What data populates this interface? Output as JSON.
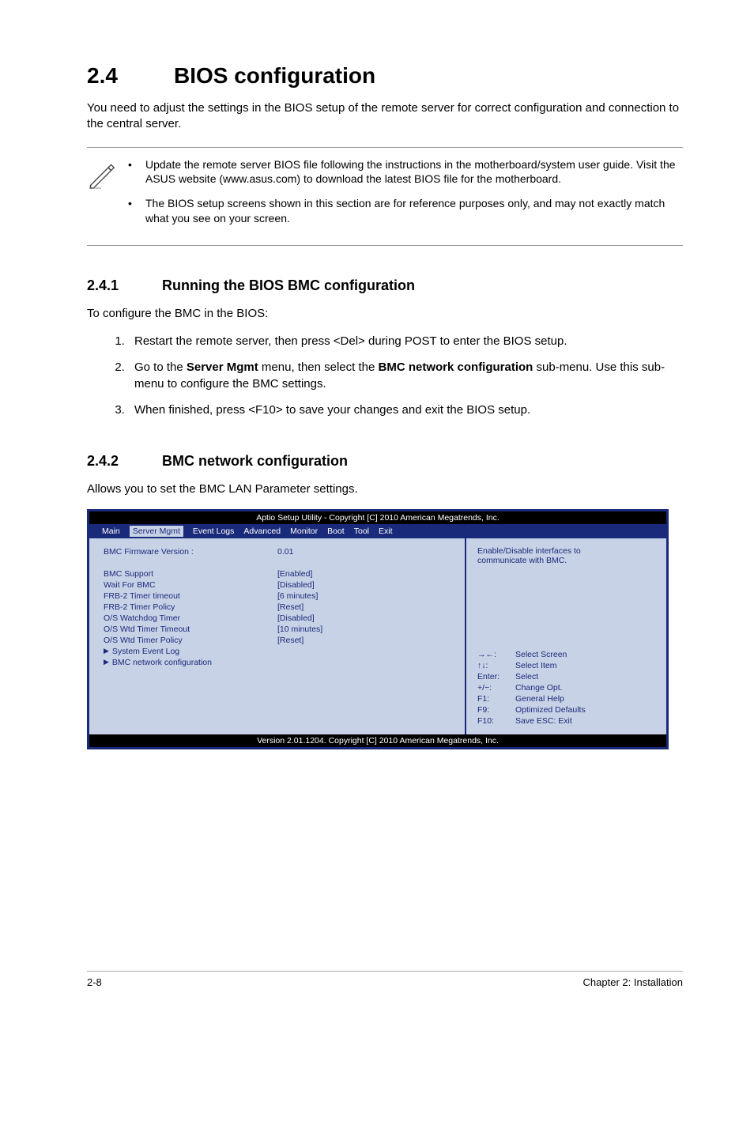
{
  "h1": {
    "num": "2.4",
    "title": "BIOS configuration"
  },
  "intro": "You need to adjust the settings in the BIOS setup of the remote server for correct configuration and connection to the central server.",
  "notes": [
    "Update the remote server BIOS file following the instructions in the motherboard/system user guide. Visit the ASUS website (www.asus.com) to download the latest BIOS file for the motherboard.",
    "The BIOS setup screens shown in this section are for reference purposes only, and may not exactly match what you see on your screen."
  ],
  "s241": {
    "num": "2.4.1",
    "title": "Running the BIOS BMC configuration"
  },
  "s241_intro": "To configure the BMC in the BIOS:",
  "steps": [
    "Restart the remote server, then press <Del> during POST to enter the BIOS setup.",
    {
      "pre": "Go to the ",
      "b1": "Server Mgmt",
      "mid": " menu, then select the ",
      "b2": "BMC network configuration",
      "post": " sub-menu. Use this sub-menu to configure the BMC settings."
    },
    "When finished, press <F10> to save your changes and exit the BIOS setup."
  ],
  "s242": {
    "num": "2.4.2",
    "title": "BMC network configuration"
  },
  "s242_intro": "Allows you to set the BMC LAN Parameter settings.",
  "bios": {
    "title": "Aptio Setup Utility - Copyright [C] 2010 American Megatrends, Inc.",
    "menu": [
      "Main",
      "Server Mgmt",
      "Event Logs",
      "Advanced",
      "Monitor",
      "Boot",
      "Tool",
      "Exit"
    ],
    "selected_menu": "Server Mgmt",
    "rows": [
      {
        "label": "BMC Firmware Version :",
        "val": "0.01"
      },
      {
        "label": "",
        "val": ""
      },
      {
        "label": "BMC Support",
        "val": "[Enabled]"
      },
      {
        "label": "Wait For BMC",
        "val": "[Disabled]"
      },
      {
        "label": "FRB-2 Timer timeout",
        "val": "[6 minutes]"
      },
      {
        "label": "FRB-2 Timer Policy",
        "val": "[Reset]"
      },
      {
        "label": "O/S Watchdog Timer",
        "val": "[Disabled]"
      },
      {
        "label": "O/S Wtd Timer Timeout",
        "val": "[10 minutes]"
      },
      {
        "label": "O/S Wtd Timer Policy",
        "val": "[Reset]"
      }
    ],
    "sub1": "System Event Log",
    "sub2": "BMC network configuration",
    "help_top1": "Enable/Disable interfaces to",
    "help_top2": "communicate with BMC.",
    "help_keys": [
      {
        "k": "→←:",
        "d": "Select Screen"
      },
      {
        "k": "↑↓:",
        "d": "Select Item"
      },
      {
        "k": "Enter:",
        "d": "Select"
      },
      {
        "k": "+/−:",
        "d": "Change Opt."
      },
      {
        "k": "F1:",
        "d": "General Help"
      },
      {
        "k": "F9:",
        "d": "Optimized Defaults"
      },
      {
        "k": "F10:",
        "d": "Save   ESC: Exit"
      }
    ],
    "footer": "Version 2.01.1204. Copyright [C] 2010 American Megatrends, Inc."
  },
  "foot": {
    "left": "2-8",
    "right": "Chapter 2: Installation"
  }
}
